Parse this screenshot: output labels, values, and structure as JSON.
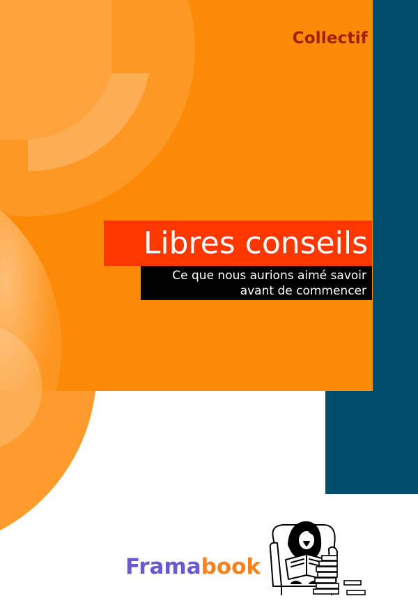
{
  "cover": {
    "author": "Collectif",
    "title": "Libres conseils",
    "subtitle_lines": [
      "Ce que nous aurions aimé savoir",
      "avant de commencer"
    ],
    "publisher": {
      "part1": "Frama",
      "part2": "book"
    },
    "mascot_icon": "penguin-reading-in-armchair-icon"
  },
  "colors": {
    "orange": "#fd8a07",
    "blue": "#004e6c",
    "title_red": "#fe3700",
    "author_red": "#9e2200",
    "framabook_purple": "#6a5acd",
    "framabook_orange": "#f5821f"
  }
}
